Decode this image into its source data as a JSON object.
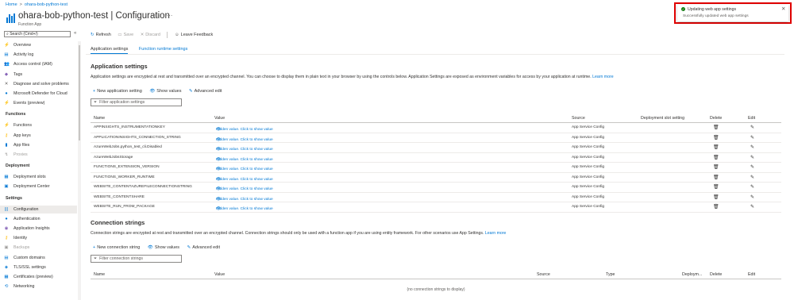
{
  "breadcrumb": {
    "home": "Home",
    "separator": ">",
    "current": "ohara-bob-python-test"
  },
  "header": {
    "title": "ohara-bob-python-test | Configuration",
    "subtitle": "Function App",
    "star_icon": "☆",
    "more_icon": "···"
  },
  "sidebar": {
    "search_placeholder": "Search (Cmd+/)",
    "collapse_icon": "«",
    "items_top": [
      {
        "label": "Overview",
        "icon": "⚡",
        "color": "#0078d4"
      },
      {
        "label": "Activity log",
        "icon": "▤",
        "color": "#0078d4"
      },
      {
        "label": "Access control (IAM)",
        "icon": "👥",
        "color": "#0078d4"
      },
      {
        "label": "Tags",
        "icon": "◆",
        "color": "#8764b8"
      },
      {
        "label": "Diagnose and solve problems",
        "icon": "✕",
        "color": "#605e5c"
      },
      {
        "label": "Microsoft Defender for Cloud",
        "icon": "●",
        "color": "#0078d4"
      },
      {
        "label": "Events (preview)",
        "icon": "⚡",
        "color": "#ffb900"
      }
    ],
    "section_functions": "Functions",
    "items_functions": [
      {
        "label": "Functions",
        "icon": "⚡",
        "color": "#0078d4"
      },
      {
        "label": "App keys",
        "icon": "⚷",
        "color": "#ffb900"
      },
      {
        "label": "App files",
        "icon": "▮",
        "color": "#0078d4"
      },
      {
        "label": "Proxies",
        "icon": "↯",
        "color": "#a19f9d",
        "disabled": true
      }
    ],
    "section_deployment": "Deployment",
    "items_deployment": [
      {
        "label": "Deployment slots",
        "icon": "▦",
        "color": "#0078d4"
      },
      {
        "label": "Deployment Center",
        "icon": "▣",
        "color": "#0078d4"
      }
    ],
    "section_settings": "Settings",
    "items_settings": [
      {
        "label": "Configuration",
        "icon": "|||",
        "color": "#0078d4",
        "active": true
      },
      {
        "label": "Authentication",
        "icon": "●",
        "color": "#0078d4"
      },
      {
        "label": "Application Insights",
        "icon": "◉",
        "color": "#8764b8"
      },
      {
        "label": "Identity",
        "icon": "⚷",
        "color": "#ffb900"
      },
      {
        "label": "Backups",
        "icon": "▣",
        "color": "#a19f9d",
        "disabled": true
      },
      {
        "label": "Custom domains",
        "icon": "▤",
        "color": "#0078d4"
      },
      {
        "label": "TLS/SSL settings",
        "icon": "◈",
        "color": "#0078d4"
      },
      {
        "label": "Certificates (preview)",
        "icon": "▦",
        "color": "#0078d4"
      },
      {
        "label": "Networking",
        "icon": "⟲",
        "color": "#0078d4"
      }
    ]
  },
  "toolbar": {
    "refresh": "Refresh",
    "save": "Save",
    "discard": "Discard",
    "feedback": "Leave Feedback",
    "refresh_icon": "↻",
    "save_icon": "▭",
    "discard_icon": "✕",
    "feedback_icon": "☺"
  },
  "tabs": {
    "app_settings": "Application settings",
    "runtime_settings": "Function runtime settings"
  },
  "app_settings": {
    "heading": "Application settings",
    "description": "Application settings are encrypted at rest and transmitted over an encrypted channel. You can choose to display them in plain text in your browser by using the controls below. Application Settings are exposed as environment variables for access by your application at runtime.",
    "learn_more": "Learn more",
    "new_label": "New application setting",
    "show_values": "Show values",
    "advanced_edit": "Advanced edit",
    "filter_placeholder": "Filter application settings",
    "columns": {
      "name": "Name",
      "value": "Value",
      "source": "Source",
      "slot": "Deployment slot setting",
      "delete": "Delete",
      "edit": "Edit"
    },
    "rows": [
      {
        "name": "APPINSIGHTS_INSTRUMENTATIONKEY",
        "value": "Hidden value. Click to show value",
        "source": "App Service Config"
      },
      {
        "name": "APPLICATIONINSIGHTS_CONNECTION_STRING",
        "value": "Hidden value. Click to show value",
        "source": "App Service Config"
      },
      {
        "name": "AzureWebJobs.python_test_cli.Disabled",
        "value": "Hidden value. Click to show value",
        "source": "App Service Config"
      },
      {
        "name": "AzureWebJobsStorage",
        "value": "Hidden value. Click to show value",
        "source": "App Service Config"
      },
      {
        "name": "FUNCTIONS_EXTENSION_VERSION",
        "value": "Hidden value. Click to show value",
        "source": "App Service Config"
      },
      {
        "name": "FUNCTIONS_WORKER_RUNTIME",
        "value": "Hidden value. Click to show value",
        "source": "App Service Config"
      },
      {
        "name": "WEBSITE_CONTENTAZUREFILECONNECTIONSTRING",
        "value": "Hidden value. Click to show value",
        "source": "App Service Config"
      },
      {
        "name": "WEBSITE_CONTENTSHARE",
        "value": "Hidden value. Click to show value",
        "source": "App Service Config"
      },
      {
        "name": "WEBSITE_RUN_FROM_PACKAGE",
        "value": "Hidden value. Click to show value",
        "source": "App Service Config"
      }
    ]
  },
  "connection_strings": {
    "heading": "Connection strings",
    "description": "Connection strings are encrypted at rest and transmitted over an encrypted channel. Connection strings should only be used with a function app if you are using entity framework. For other scenarios use App Settings.",
    "learn_more": "Learn more",
    "new_label": "New connection string",
    "show_values": "Show values",
    "advanced_edit": "Advanced edit",
    "filter_placeholder": "Filter connection strings",
    "columns": {
      "name": "Name",
      "value": "Value",
      "source": "Source",
      "type": "Type",
      "slot": "Deploym...",
      "delete": "Delete",
      "edit": "Edit"
    },
    "empty": "(no connection strings to display)"
  },
  "notification": {
    "title": "Updating web app settings",
    "message": "Successfully updated web app settings",
    "close_icon": "✕",
    "success_color": "#107c10",
    "highlight_color": "#e00000"
  }
}
